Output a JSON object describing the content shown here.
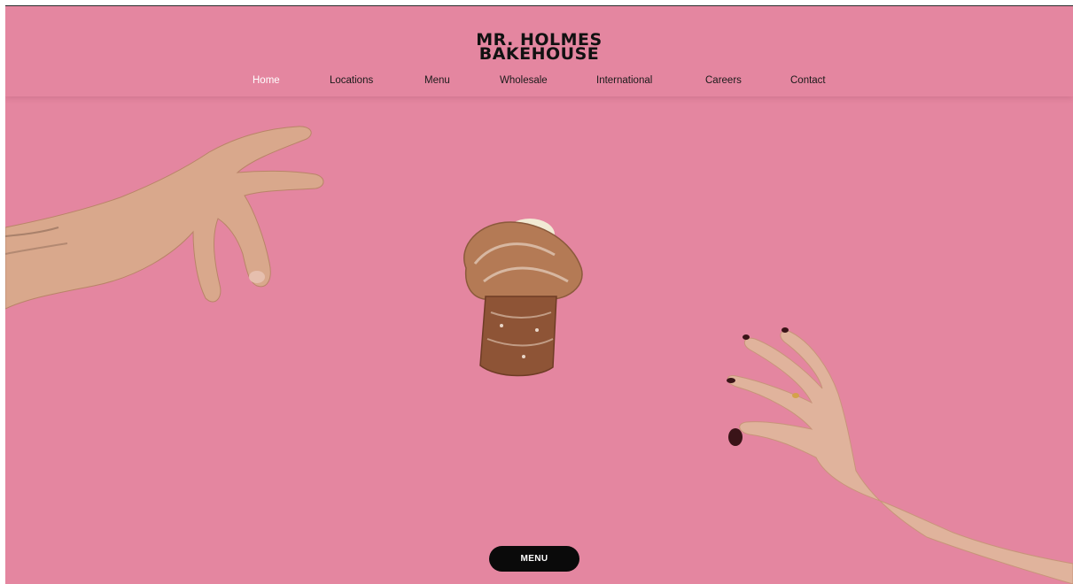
{
  "brand": {
    "line1": "MR. HOLMES",
    "line2": "BAKEHOUSE"
  },
  "nav": {
    "items": [
      {
        "label": "Home",
        "active": true
      },
      {
        "label": "Locations"
      },
      {
        "label": "Menu"
      },
      {
        "label": "Wholesale"
      },
      {
        "label": "International"
      },
      {
        "label": "Careers"
      },
      {
        "label": "Contact"
      }
    ]
  },
  "hero": {
    "background_color": "#e486a0"
  },
  "cta": {
    "menu_label": "MENU"
  }
}
